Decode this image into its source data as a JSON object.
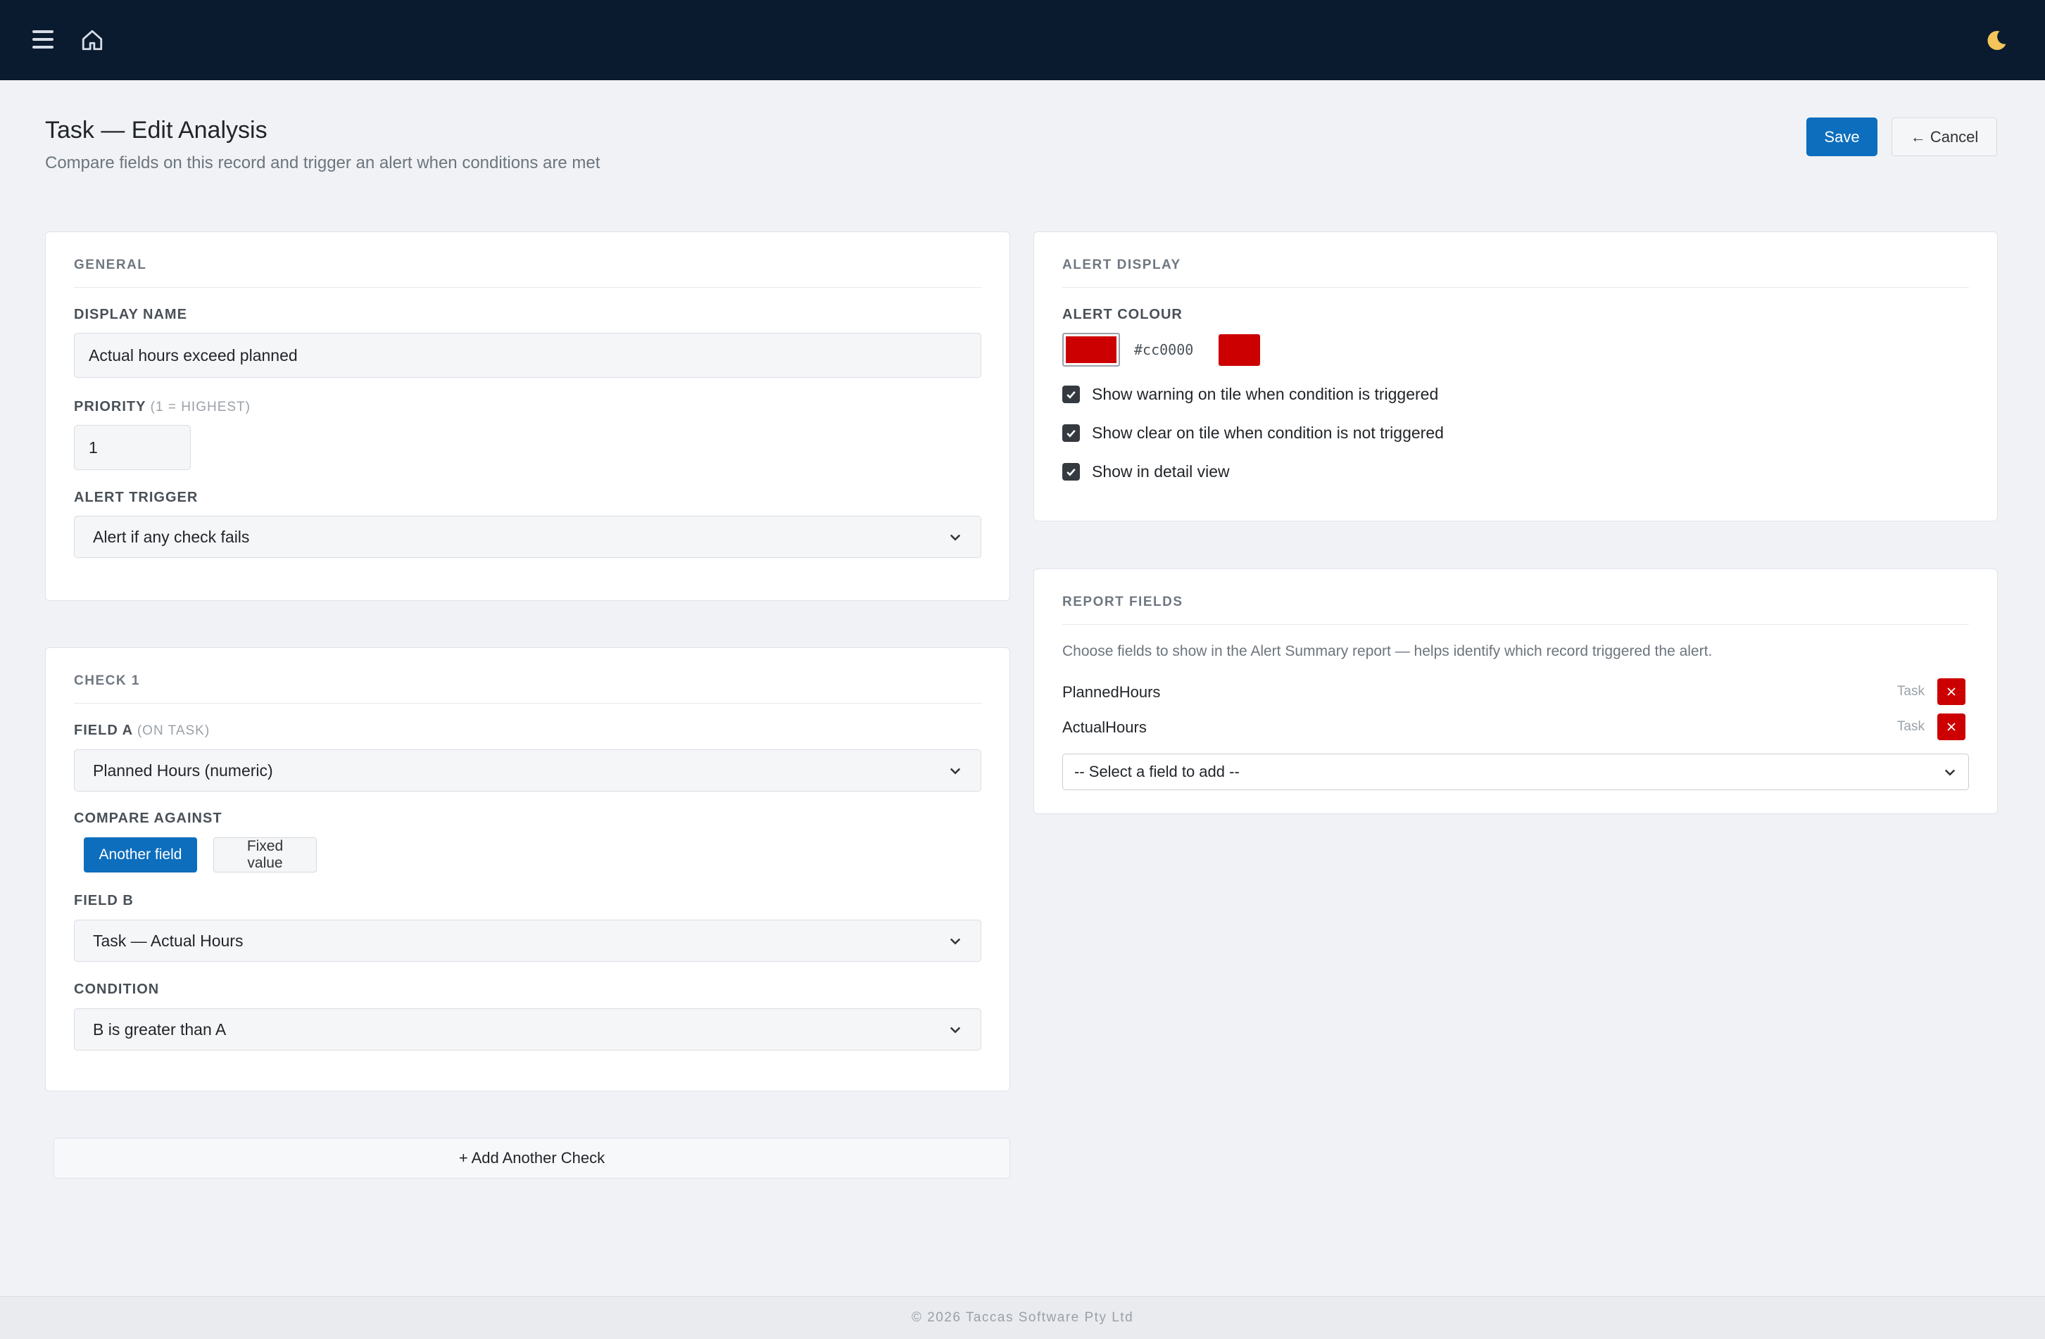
{
  "header": {
    "menu_icon": "hamburger-menu-icon",
    "home_icon": "home-icon",
    "theme_icon": "moon-icon"
  },
  "page": {
    "title": "Task — Edit Analysis",
    "subtitle": "Compare fields on this record and trigger an alert when conditions are met",
    "save_label": "Save",
    "cancel_label": "← Cancel"
  },
  "general": {
    "section_title": "GENERAL",
    "display_name_label": "DISPLAY NAME",
    "display_name_value": "Actual hours exceed planned",
    "priority_label": "PRIORITY",
    "priority_hint": "(1 = HIGHEST)",
    "priority_value": "1",
    "alert_trigger_label": "ALERT TRIGGER",
    "alert_trigger_value": "Alert if any check fails"
  },
  "check1": {
    "section_title": "CHECK 1",
    "field_a_label": "FIELD A",
    "field_a_hint": "(ON TASK)",
    "field_a_value": "Planned Hours (numeric)",
    "compare_label": "COMPARE AGAINST",
    "compare_options": [
      "Another field",
      "Fixed value"
    ],
    "compare_selected": "Another field",
    "field_b_label": "FIELD B",
    "field_b_value": "Task — Actual Hours",
    "condition_label": "CONDITION",
    "condition_value": "B is greater than A"
  },
  "add_check_label": "+ Add Another Check",
  "alert_display": {
    "section_title": "ALERT DISPLAY",
    "colour_label": "ALERT COLOUR",
    "colour_hex": "#cc0000",
    "checkboxes": [
      {
        "label": "Show warning on tile when condition is triggered",
        "checked": true
      },
      {
        "label": "Show clear on tile when condition is not triggered",
        "checked": true
      },
      {
        "label": "Show in detail view",
        "checked": true
      }
    ]
  },
  "report_fields": {
    "section_title": "REPORT FIELDS",
    "description": "Choose fields to show in the Alert Summary report — helps identify which record triggered the alert.",
    "fields": [
      {
        "name": "PlannedHours",
        "entity": "Task"
      },
      {
        "name": "ActualHours",
        "entity": "Task"
      }
    ],
    "add_placeholder": "-- Select a field to add --"
  },
  "footer": {
    "text": "© 2026 Taccas Software Pty Ltd"
  },
  "colors": {
    "navbar": "#0a1a2f",
    "primary": "#0d6ebd",
    "alert": "#cc0000",
    "page_bg": "#f0f2f6"
  }
}
